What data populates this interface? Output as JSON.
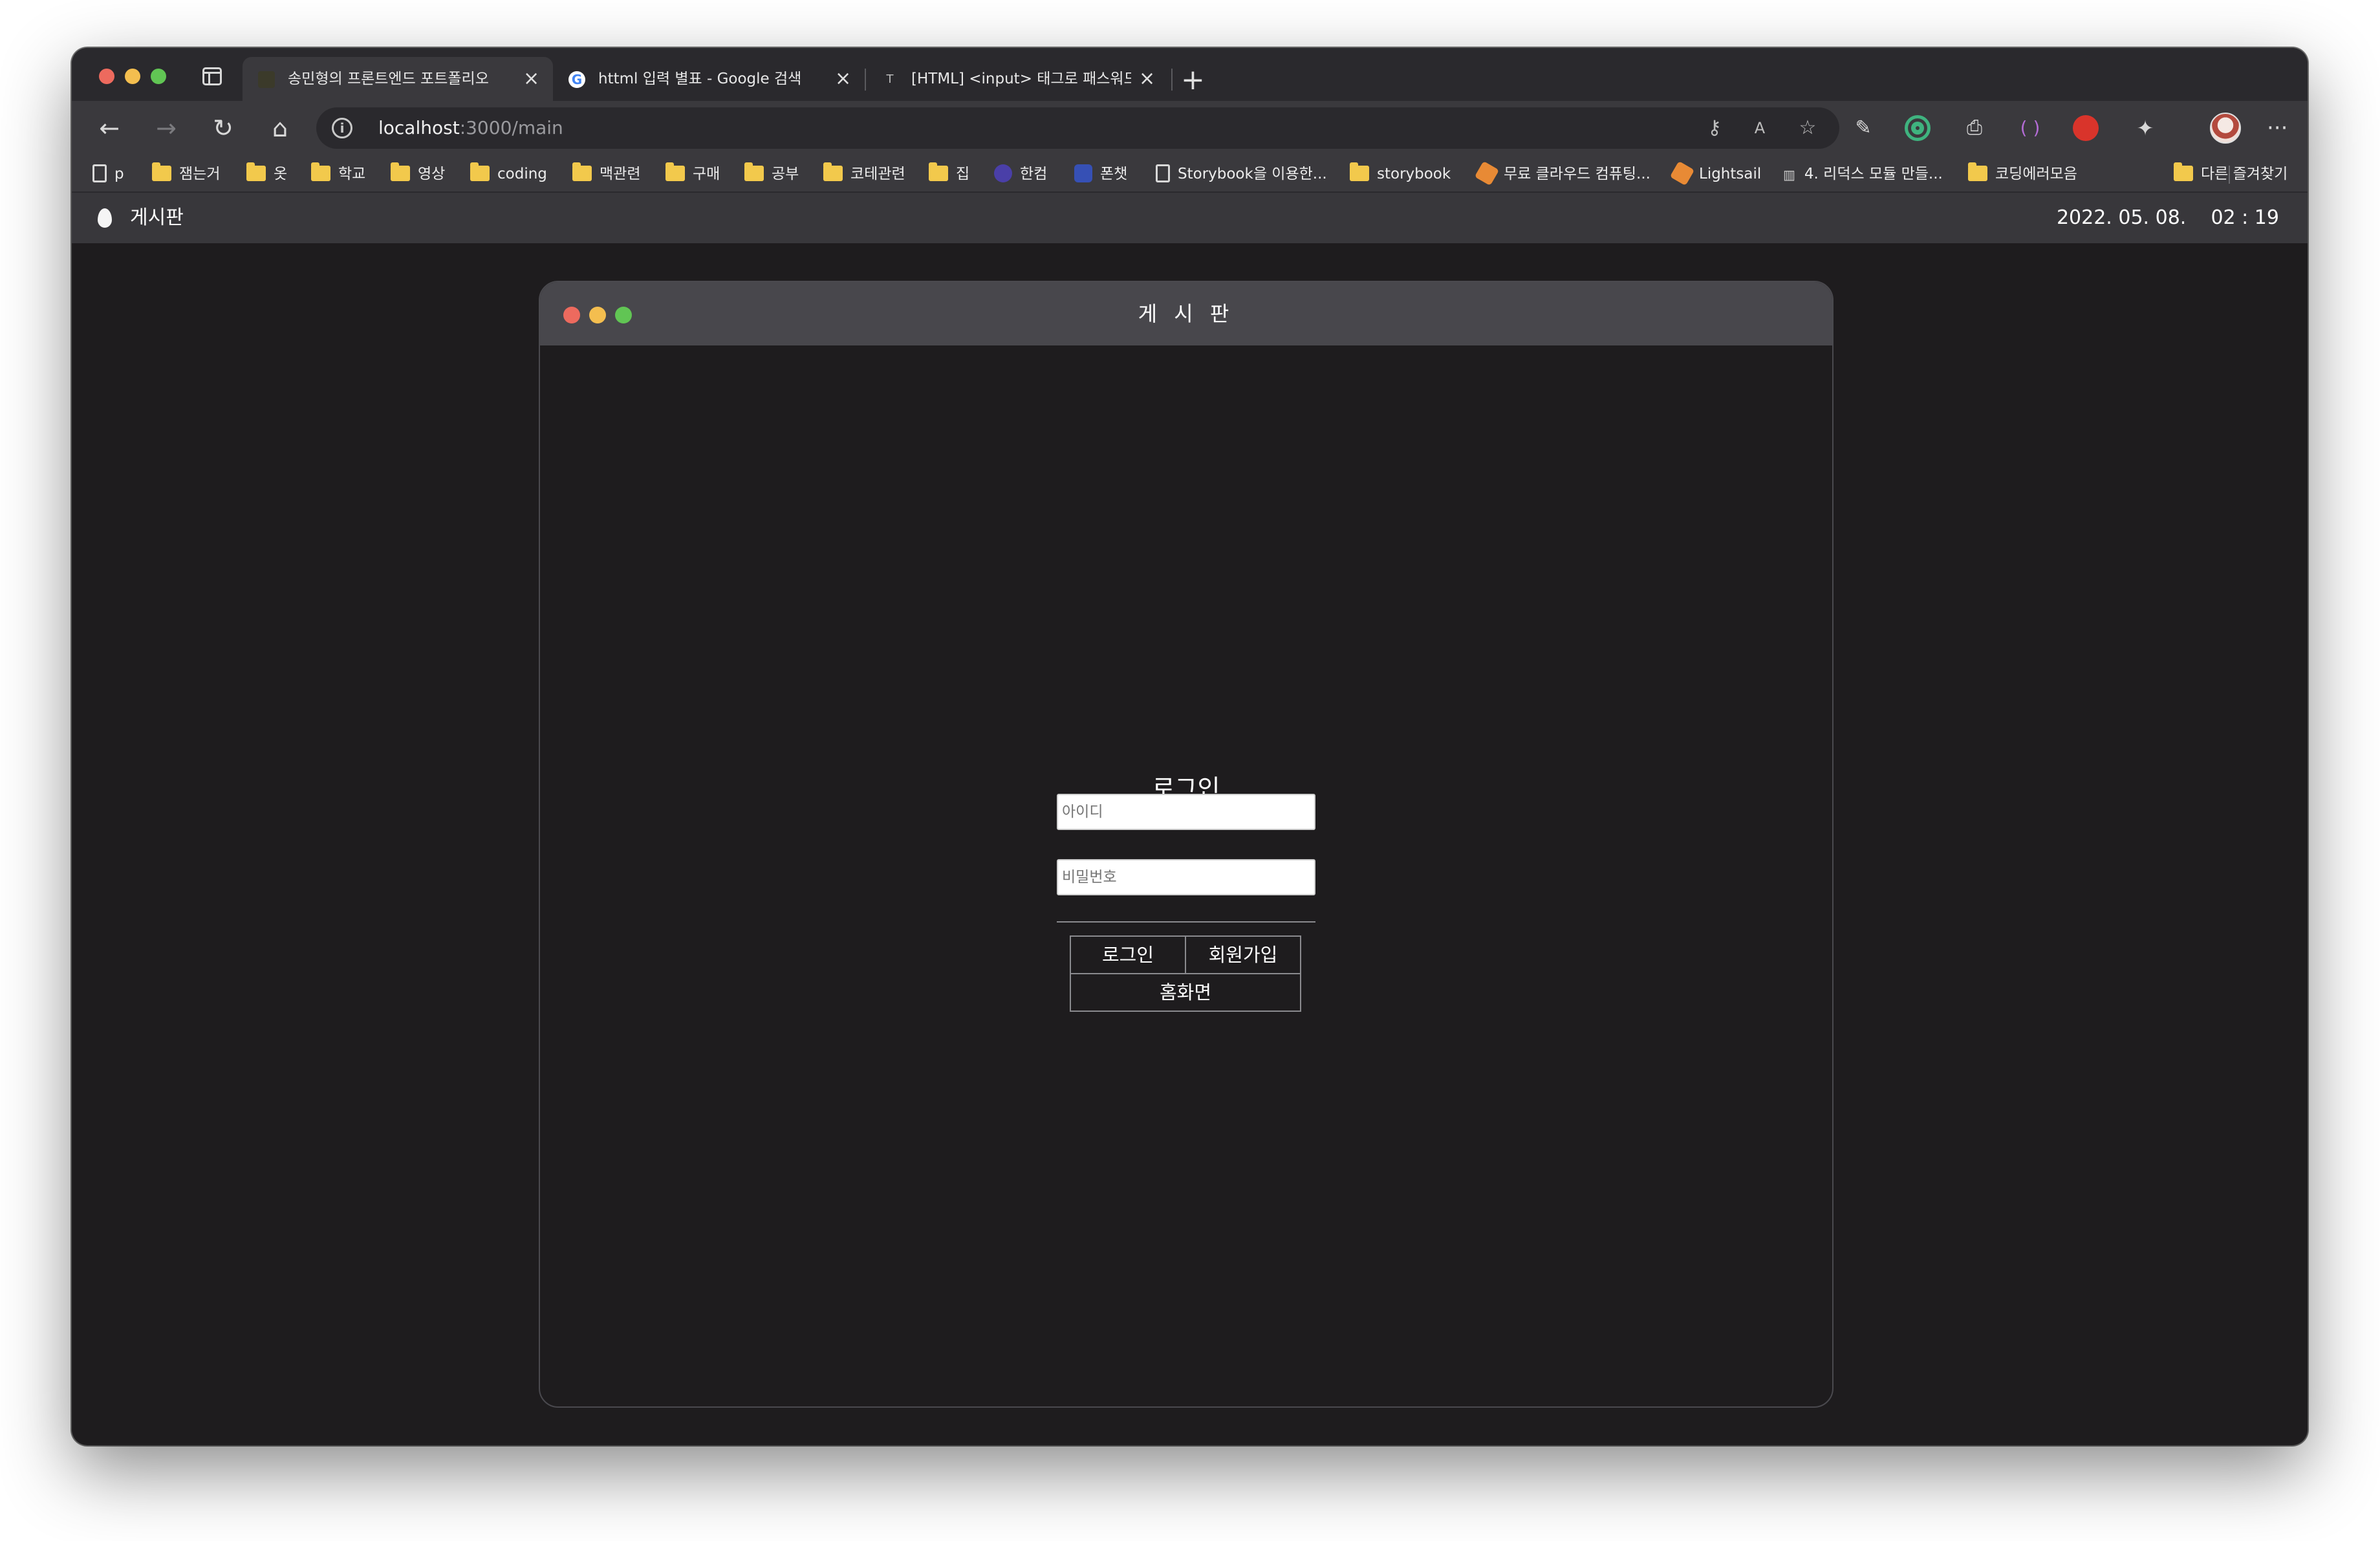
{
  "browser": {
    "tabs": [
      {
        "title": "송민형의 프론트엔드 포트폴리오",
        "active": true
      },
      {
        "title": "httml 입력 별표 - Google 검색",
        "active": false
      },
      {
        "title": "[HTML] <input> 태그로 패스워드",
        "active": false
      }
    ],
    "new_tab_symbol": "+",
    "close_symbol": "×",
    "url": {
      "host": "localhost",
      "path": ":3000/main"
    },
    "bookmarks": [
      {
        "label": "p",
        "icon": "page-icon"
      },
      {
        "label": "잼는거",
        "icon": "folder-icon"
      },
      {
        "label": "옷",
        "icon": "folder-icon"
      },
      {
        "label": "학교",
        "icon": "folder-icon"
      },
      {
        "label": "영상",
        "icon": "folder-icon"
      },
      {
        "label": "coding",
        "icon": "folder-icon"
      },
      {
        "label": "맥관련",
        "icon": "folder-icon"
      },
      {
        "label": "구매",
        "icon": "folder-icon"
      },
      {
        "label": "공부",
        "icon": "folder-icon"
      },
      {
        "label": "코테관련",
        "icon": "folder-icon"
      },
      {
        "label": "집",
        "icon": "folder-icon"
      },
      {
        "label": "한컴",
        "icon": "hancom-icon"
      },
      {
        "label": "폰챗",
        "icon": "phonechat-icon"
      },
      {
        "label": "Storybook을 이용한...",
        "icon": "page-icon"
      },
      {
        "label": "storybook",
        "icon": "folder-icon"
      },
      {
        "label": "무료 클라우드 컴퓨팅...",
        "icon": "aws-icon"
      },
      {
        "label": "Lightsail",
        "icon": "aws-icon"
      },
      {
        "label": "4. 리덕스 모듈 만들...",
        "icon": "book-icon"
      },
      {
        "label": "코딩에러모음",
        "icon": "folder-icon"
      }
    ],
    "other_bookmarks": "다른 즐겨찾기"
  },
  "app": {
    "title": "게시판",
    "clock": "2022. 05. 08.    02 : 19"
  },
  "modal": {
    "title": "게 시 판"
  },
  "login": {
    "heading": "로그인",
    "id_placeholder": "아이디",
    "password_placeholder": "비밀번호",
    "login_button": "로그인",
    "signup_button": "회원가입",
    "home_button": "홈화면"
  },
  "colors": {
    "background": "#1e1c1e",
    "traffic_red": "#ed6a5e",
    "traffic_yellow": "#f4be4f",
    "traffic_green": "#61c554"
  }
}
